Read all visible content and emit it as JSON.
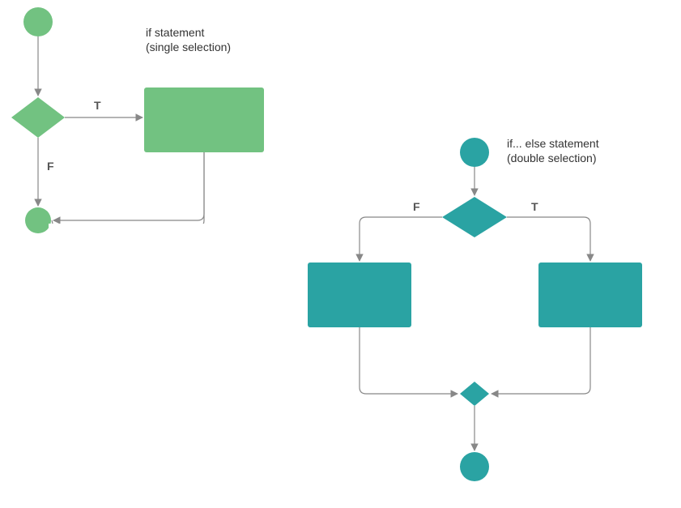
{
  "colors": {
    "green": "#72c281",
    "teal": "#2aa3a3",
    "edge": "#888888",
    "label": "#555555"
  },
  "left": {
    "title_line1": "if statement",
    "title_line2": "(single selection)",
    "true_label": "T",
    "false_label": "F"
  },
  "right": {
    "title_line1": "if... else statement",
    "title_line2": "(double selection)",
    "true_label": "T",
    "false_label": "F"
  }
}
